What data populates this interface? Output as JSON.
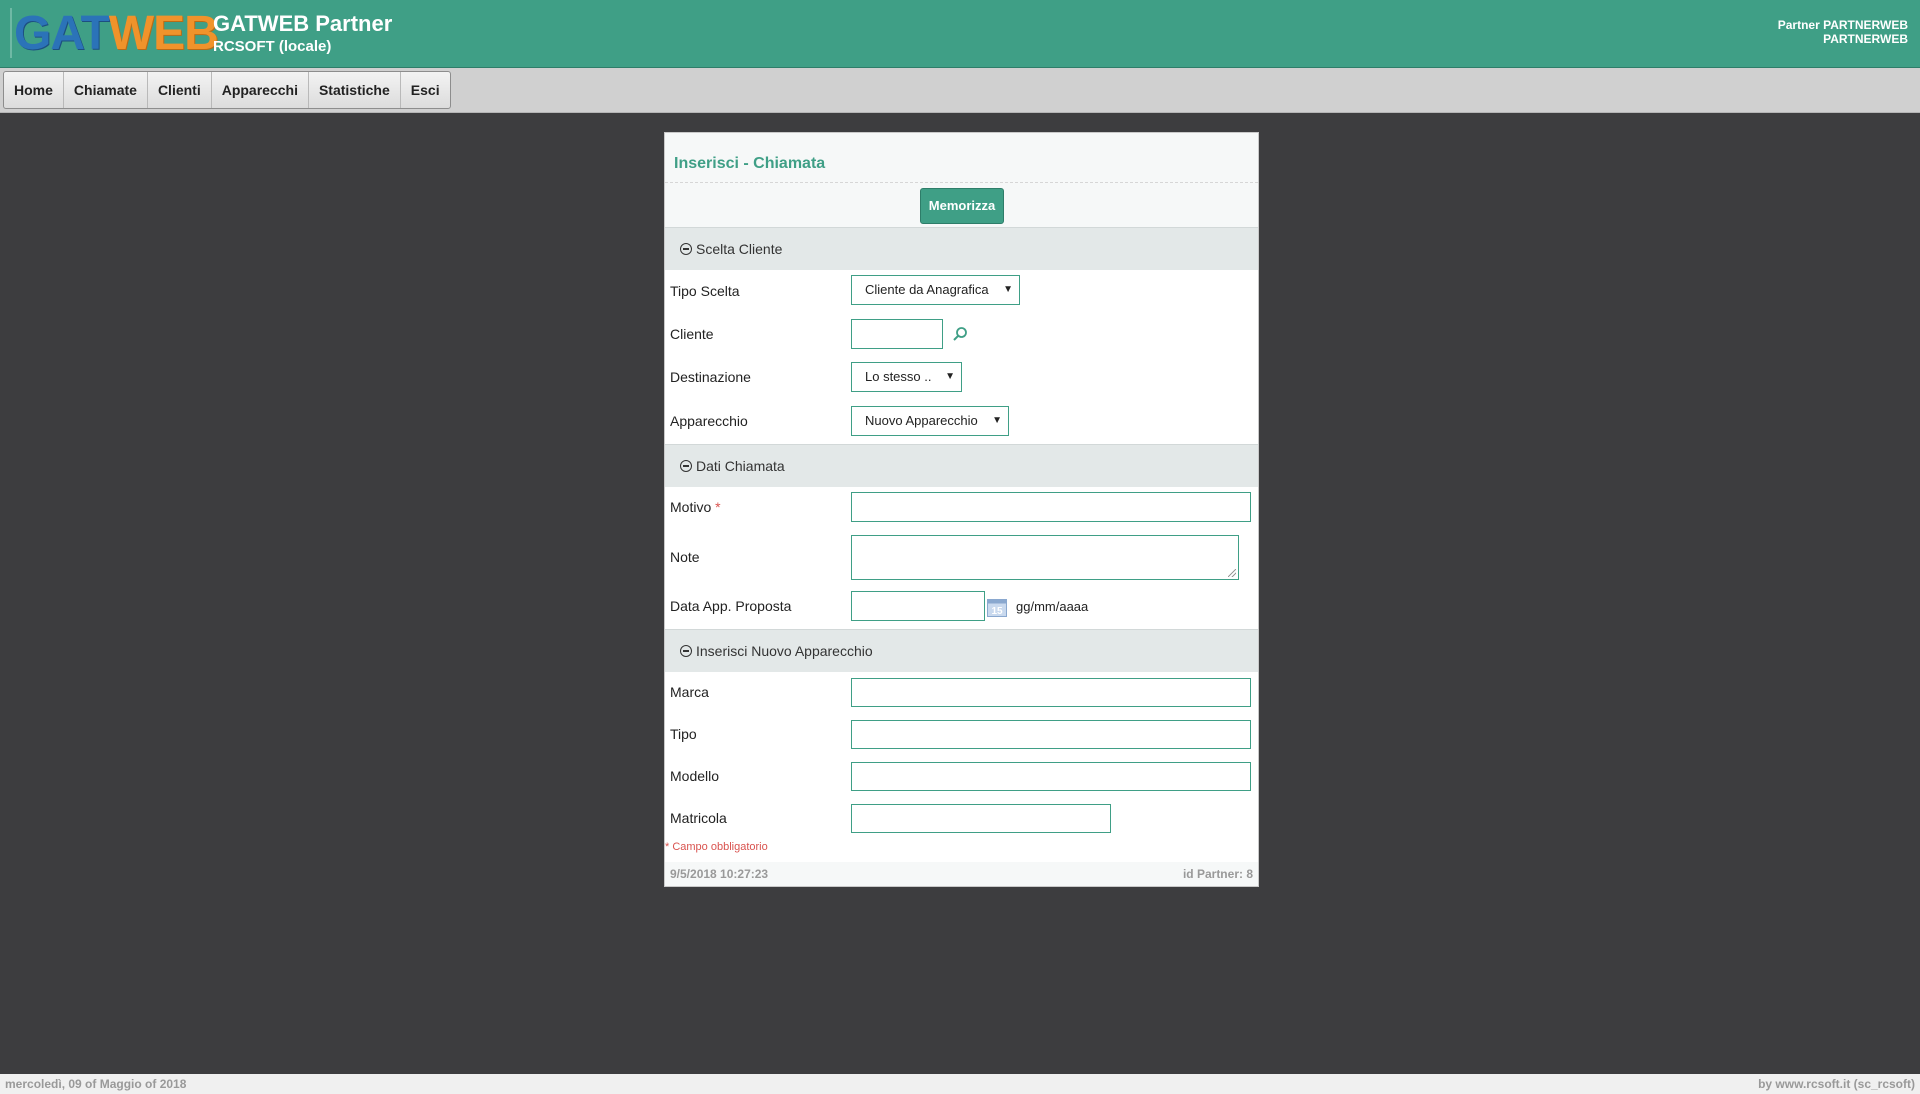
{
  "header": {
    "logo_part1": "GAT",
    "logo_part2": "WEB",
    "title": "GATWEB Partner",
    "subtitle": "RCSOFT (locale)",
    "user_line1": "Partner PARTNERWEB",
    "user_line2": "PARTNERWEB"
  },
  "nav": {
    "items": [
      {
        "label": "Home"
      },
      {
        "label": "Chiamate"
      },
      {
        "label": "Clienti"
      },
      {
        "label": "Apparecchi"
      },
      {
        "label": "Statistiche"
      },
      {
        "label": "Esci"
      }
    ]
  },
  "form": {
    "title": "Inserisci - Chiamata",
    "save_label": "Memorizza",
    "sections": {
      "cliente": "Scelta Cliente",
      "dati": "Dati Chiamata",
      "apparecchio": "Inserisci Nuovo Apparecchio"
    },
    "fields": {
      "tipo_scelta": {
        "label": "Tipo Scelta",
        "value": "Cliente da Anagrafica"
      },
      "cliente": {
        "label": "Cliente",
        "value": ""
      },
      "destinazione": {
        "label": "Destinazione",
        "value": "Lo stesso .."
      },
      "apparecchio": {
        "label": "Apparecchio",
        "value": "Nuovo Apparecchio"
      },
      "motivo": {
        "label": "Motivo",
        "required_mark": "*",
        "value": ""
      },
      "note": {
        "label": "Note",
        "value": ""
      },
      "data_app": {
        "label": "Data App. Proposta",
        "value": "",
        "format_hint": "gg/mm/aaaa"
      },
      "marca": {
        "label": "Marca",
        "value": ""
      },
      "tipo": {
        "label": "Tipo",
        "value": ""
      },
      "modello": {
        "label": "Modello",
        "value": ""
      },
      "matricola": {
        "label": "Matricola",
        "value": ""
      }
    },
    "required_note": "* Campo obbligatorio",
    "timestamp": "9/5/2018 10:27:23",
    "partner_id": "id Partner: 8"
  },
  "statusbar": {
    "date": "mercoledì, 09 of Maggio of 2018",
    "credit": "by www.rcsoft.it (sc_rcsoft)"
  },
  "colors": {
    "header": "#3f9f86",
    "accent": "#3f9f86",
    "background": "#3d3d3f"
  }
}
